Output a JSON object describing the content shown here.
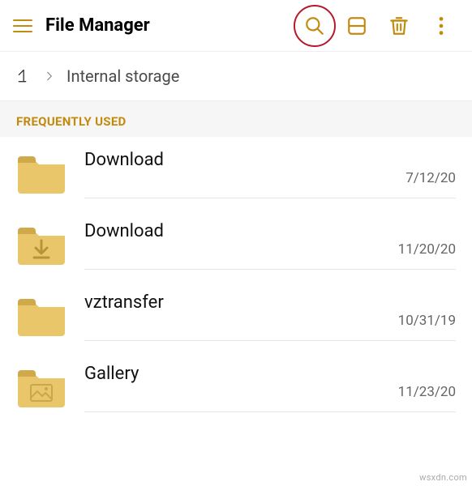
{
  "toolbar": {
    "title": "File Manager"
  },
  "breadcrumb": {
    "location": "Internal storage"
  },
  "section": {
    "title": "FREQUENTLY USED"
  },
  "items": [
    {
      "name": "Download",
      "date": "7/12/20",
      "icon": "folder"
    },
    {
      "name": "Download",
      "date": "11/20/20",
      "icon": "folder-download"
    },
    {
      "name": "vztransfer",
      "date": "10/31/19",
      "icon": "folder"
    },
    {
      "name": "Gallery",
      "date": "11/23/20",
      "icon": "folder-image"
    }
  ],
  "watermark": "wsxdn.com",
  "colors": {
    "accent": "#c28a0e",
    "highlight": "#b5192b",
    "folder": "#e9c66a",
    "folderDark": "#cfa94a"
  }
}
